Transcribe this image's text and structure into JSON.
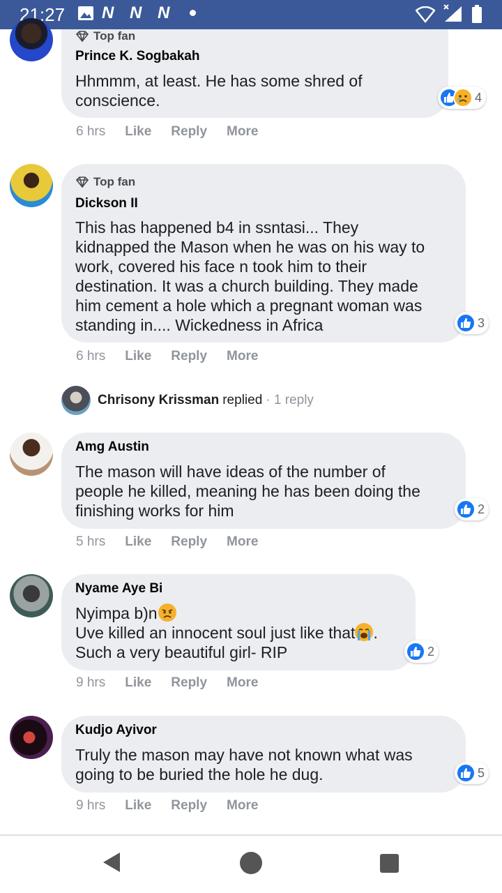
{
  "status_bar": {
    "time": "21:27",
    "notification_icons": [
      "gallery-icon",
      "n-icon",
      "n-icon",
      "n-icon",
      "dot-icon"
    ],
    "n_glyph": "N",
    "system_icons": [
      "wifi-icon",
      "signal-icon",
      "battery-icon"
    ],
    "background_color": "#3b5998"
  },
  "badge_label": "Top fan",
  "actions": {
    "like": "Like",
    "reply": "Reply",
    "more": "More"
  },
  "comments": [
    {
      "badge": "Top fan",
      "author": "Prince K. Sogbakah",
      "text": "Hhmmm, at least. He has some shred of\nconscience.",
      "reactions": [
        "like",
        "sad"
      ],
      "reaction_count": "4",
      "time": "6 hrs"
    },
    {
      "badge": "Top fan",
      "author": "Dickson II",
      "text": "This has happened b4 in ssntasi... They\nkidnapped the Mason when he was on his way to\nwork, covered his face n took him to their\ndestination. It was a church building. They made\nhim cement a hole which a pregnant woman was\nstanding in.... Wickedness in Africa",
      "reactions": [
        "like"
      ],
      "reaction_count": "3",
      "time": "6 hrs"
    },
    {
      "author": "Amg Austin",
      "text": "The mason will have ideas of the number of\npeople he killed, meaning he has been doing the\nfinishing works for him",
      "reactions": [
        "like"
      ],
      "reaction_count": "2",
      "time": "5 hrs"
    },
    {
      "author": "Nyame Aye Bi",
      "text_line1": "Nyimpa b)n",
      "text_line2": "Uve killed an innocent soul just like that",
      "text_line2_end": ".",
      "text_line3": "Such a very beautiful girl- RIP",
      "reactions": [
        "like"
      ],
      "reaction_count": "2",
      "time": "9 hrs"
    },
    {
      "author": "Kudjo Ayivor",
      "text": "Truly the mason may have not known what was\ngoing to be buried the hole he dug.",
      "reactions": [
        "like"
      ],
      "reaction_count": "5",
      "time": "9 hrs"
    }
  ],
  "reply_summary": {
    "name": "Chrisony Krissman",
    "verb": "replied",
    "count": "· 1 reply"
  },
  "nav": {
    "icons": [
      "back-icon",
      "home-icon",
      "recents-icon"
    ]
  },
  "colors": {
    "like_blue": "#1877f2",
    "bubble_gray": "#ebedf0",
    "meta_gray": "#90949c"
  }
}
